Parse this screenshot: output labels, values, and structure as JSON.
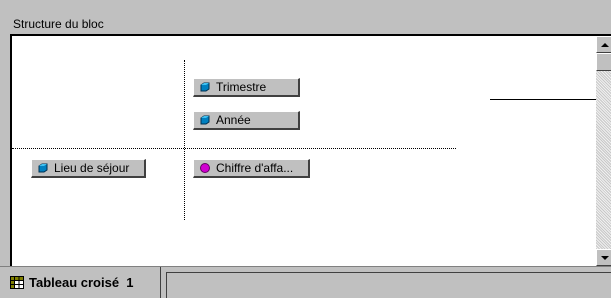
{
  "window": {
    "title": "Structure du bloc"
  },
  "block": {
    "columns": [
      {
        "label": "Trimestre",
        "icon": "dimension-icon"
      },
      {
        "label": "Année",
        "icon": "dimension-icon"
      }
    ],
    "rows": [
      {
        "label": "Lieu de séjour",
        "icon": "dimension-icon"
      }
    ],
    "body": [
      {
        "label": "Chiffre d'affa...",
        "icon": "measure-icon"
      }
    ]
  },
  "tabs": [
    {
      "label": "Tableau croisé  1",
      "icon": "crosstab-icon"
    }
  ],
  "colors": {
    "face": "#c0c0c0",
    "panel": "#ffffff",
    "measure": "#d000d0",
    "dimension": "#0060a0"
  }
}
